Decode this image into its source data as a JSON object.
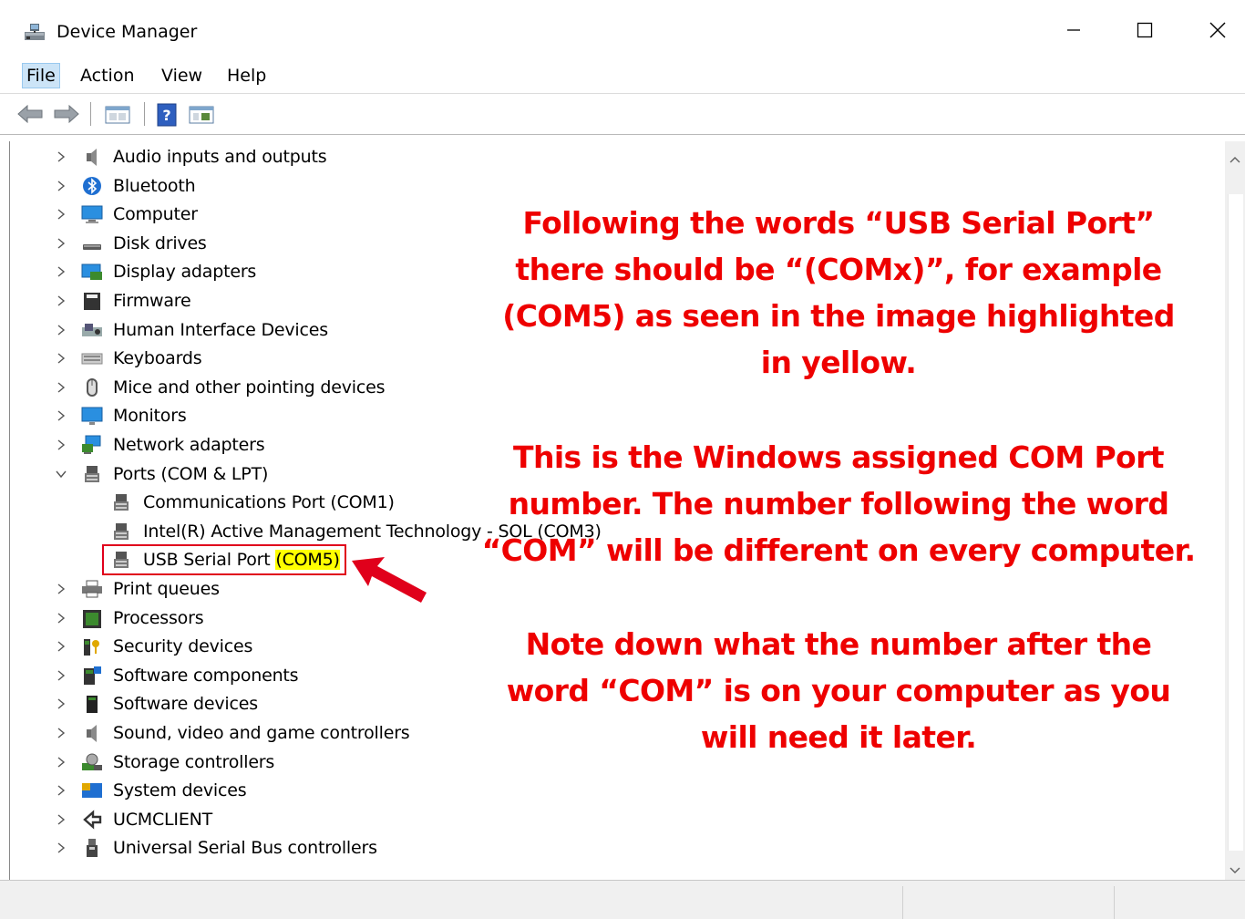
{
  "window": {
    "title": "Device Manager",
    "controls": [
      "minimize-icon",
      "maximize-icon",
      "close-icon"
    ]
  },
  "menu": {
    "file": "File",
    "action": "Action",
    "view": "View",
    "help": "Help"
  },
  "toolbar": [
    "back-arrow-icon",
    "forward-arrow-icon",
    "properties-icon",
    "help-icon",
    "scan-hardware-icon"
  ],
  "tree": {
    "categories_before": [
      {
        "label": "Audio inputs and outputs",
        "icon": "speaker-icon"
      },
      {
        "label": "Bluetooth",
        "icon": "bluetooth-icon"
      },
      {
        "label": "Computer",
        "icon": "computer-icon"
      },
      {
        "label": "Disk drives",
        "icon": "disk-drive-icon"
      },
      {
        "label": "Display adapters",
        "icon": "display-adapter-icon"
      },
      {
        "label": "Firmware",
        "icon": "firmware-icon"
      },
      {
        "label": "Human Interface Devices",
        "icon": "hid-icon"
      },
      {
        "label": "Keyboards",
        "icon": "keyboard-icon"
      },
      {
        "label": "Mice and other pointing devices",
        "icon": "mouse-icon"
      },
      {
        "label": "Monitors",
        "icon": "monitor-icon"
      },
      {
        "label": "Network adapters",
        "icon": "network-adapter-icon"
      }
    ],
    "ports": {
      "label": "Ports (COM & LPT)",
      "children": [
        {
          "label": "Communications Port (COM1)"
        },
        {
          "label": "Intel(R) Active Management Technology - SOL (COM3)"
        },
        {
          "label_prefix": "USB Serial Port ",
          "label_highlight": "(COM5)"
        }
      ]
    },
    "categories_after": [
      {
        "label": "Print queues",
        "icon": "printer-icon"
      },
      {
        "label": "Processors",
        "icon": "processor-icon"
      },
      {
        "label": "Security devices",
        "icon": "security-icon"
      },
      {
        "label": "Software components",
        "icon": "software-component-icon"
      },
      {
        "label": "Software devices",
        "icon": "software-device-icon"
      },
      {
        "label": "Sound, video and game controllers",
        "icon": "speaker-icon"
      },
      {
        "label": "Storage controllers",
        "icon": "storage-controller-icon"
      },
      {
        "label": "System devices",
        "icon": "system-devices-icon"
      },
      {
        "label": "UCMCLIENT",
        "icon": "ucm-icon"
      },
      {
        "label": "Universal Serial Bus controllers",
        "icon": "usb-icon"
      }
    ]
  },
  "annotation": {
    "paragraph1": [
      "Following the words “USB Serial Port”",
      "there should be “(COMx)”, for example",
      "(COM5) as seen in the image highlighted",
      "in yellow."
    ],
    "paragraph2": [
      "This is the Windows assigned COM Port",
      "number. The number following the word",
      "“COM” will be different on every computer."
    ],
    "paragraph3": [
      "Note down what the number after the",
      "word “COM” is on your computer as you",
      "will need it later."
    ],
    "text_color": "#ee0000",
    "highlight_color": "#ffff00",
    "arrow_color": "#e0001b"
  }
}
